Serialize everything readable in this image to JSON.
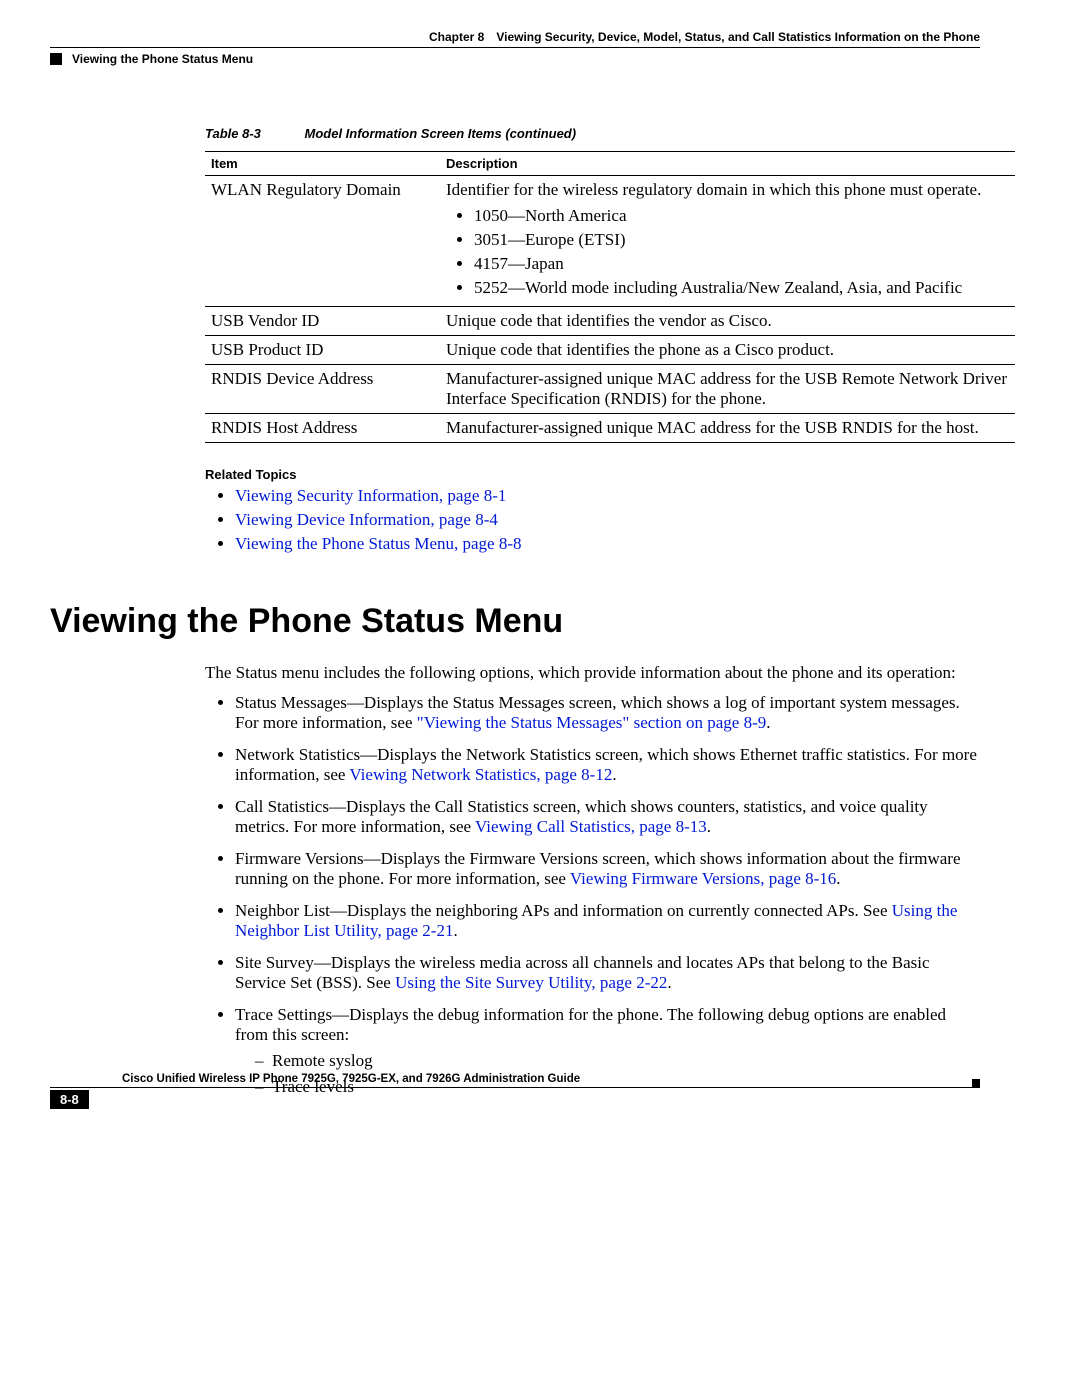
{
  "header": {
    "chapter_label": "Chapter 8",
    "chapter_title": "Viewing Security, Device, Model, Status, and Call Statistics Information on the Phone",
    "section_title": "Viewing the Phone Status Menu"
  },
  "table": {
    "label": "Table 8-3",
    "caption": "Model Information Screen Items (continued)",
    "col_item": "Item",
    "col_desc": "Description",
    "rows": [
      {
        "item": "WLAN Regulatory Domain",
        "desc_intro": "Identifier for the wireless regulatory domain in which this phone must operate.",
        "bullets": [
          "1050—North America",
          "3051—Europe (ETSI)",
          "4157—Japan",
          "5252—World mode including Australia/New Zealand, Asia, and Pacific"
        ]
      },
      {
        "item": "USB Vendor ID",
        "desc": "Unique code that identifies the vendor as Cisco."
      },
      {
        "item": "USB Product ID",
        "desc": "Unique code that identifies the phone as a Cisco product."
      },
      {
        "item": "RNDIS Device Address",
        "desc": "Manufacturer-assigned unique MAC address for the USB Remote Network Driver Interface Specification (RNDIS) for the phone."
      },
      {
        "item": "RNDIS Host Address",
        "desc": "Manufacturer-assigned unique MAC address for the USB RNDIS for the host."
      }
    ]
  },
  "related": {
    "heading": "Related Topics",
    "links": [
      "Viewing Security Information, page 8-1",
      "Viewing Device Information, page 8-4",
      "Viewing the Phone Status Menu, page 8-8"
    ]
  },
  "heading_main": "Viewing the Phone Status Menu",
  "intro": "The Status menu includes the following options, which provide information about the phone and its operation:",
  "status_items": [
    {
      "pre": "Status Messages—Displays the Status Messages screen, which shows a log of important system messages. For more information, see ",
      "link": "\"Viewing the Status Messages\" section on page 8-9",
      "post": "."
    },
    {
      "pre": "Network Statistics—Displays the Network Statistics screen, which shows Ethernet traffic statistics. For more information, see ",
      "link": "Viewing Network Statistics, page 8-12",
      "post": "."
    },
    {
      "pre": "Call Statistics—Displays the Call Statistics screen, which shows counters, statistics, and voice quality metrics. For more information, see ",
      "link": "Viewing Call Statistics, page 8-13",
      "post": "."
    },
    {
      "pre": "Firmware Versions—Displays the Firmware Versions screen, which shows information about the firmware running on the phone. For more information, see ",
      "link": "Viewing Firmware Versions, page 8-16",
      "post": "."
    },
    {
      "pre": "Neighbor List—Displays the neighboring APs and information on currently connected APs. See ",
      "link": "Using the Neighbor List Utility, page 2-21",
      "post": "."
    },
    {
      "pre": "Site Survey—Displays the wireless media across all channels and locates APs that belong to the Basic Service Set (BSS). See ",
      "link": "Using the Site Survey Utility, page 2-22",
      "post": "."
    },
    {
      "pre": "Trace Settings—Displays the debug information for the phone. The following debug options are enabled from this screen:",
      "sub": [
        "Remote syslog",
        "Trace levels"
      ]
    }
  ],
  "footer": {
    "doc_title": "Cisco Unified Wireless IP Phone 7925G, 7925G-EX, and 7926G Administration Guide",
    "page": "8-8"
  }
}
